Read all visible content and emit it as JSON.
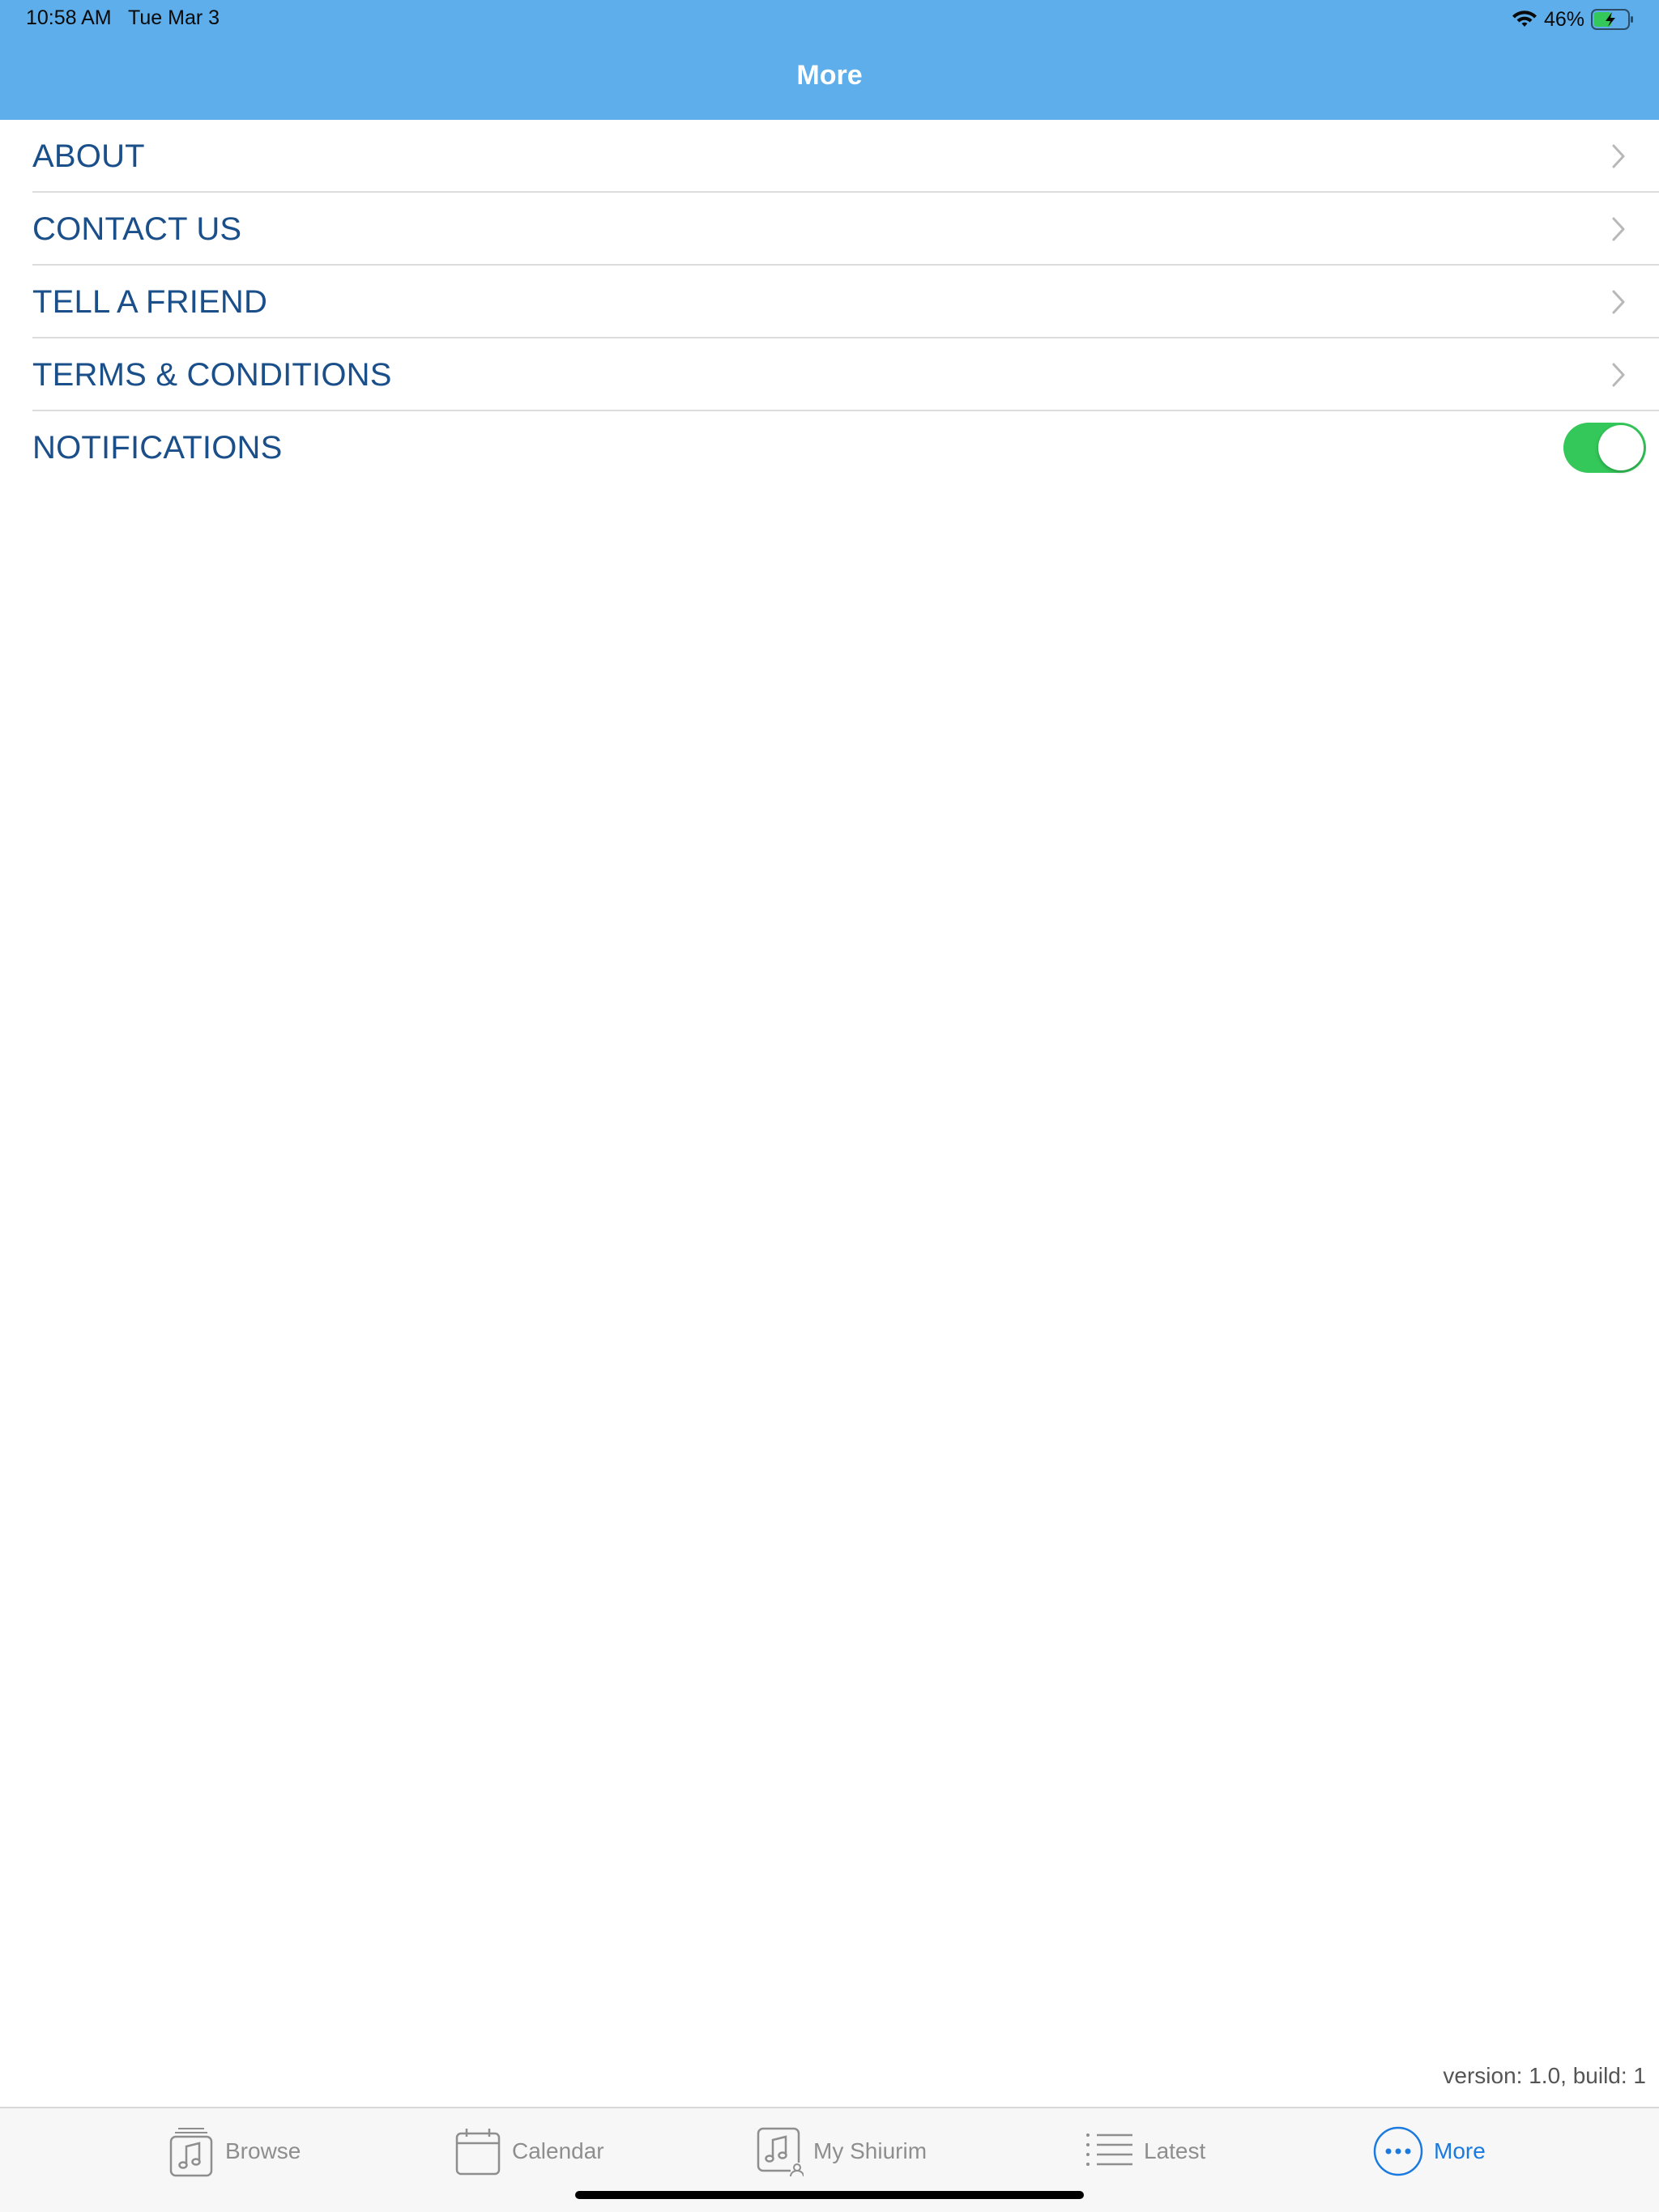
{
  "status_bar": {
    "time": "10:58 AM",
    "date": "Tue Mar 3",
    "battery": "46%"
  },
  "nav": {
    "title": "More"
  },
  "menu": {
    "items": [
      {
        "label": "ABOUT"
      },
      {
        "label": "CONTACT US"
      },
      {
        "label": "TELL A FRIEND"
      },
      {
        "label": "TERMS & CONDITIONS"
      }
    ],
    "notifications": {
      "label": "NOTIFICATIONS",
      "enabled": true
    }
  },
  "version_text": "version: 1.0, build: 1",
  "tabs": [
    {
      "label": "Browse",
      "icon": "music-note-stack-icon"
    },
    {
      "label": "Calendar",
      "icon": "calendar-icon"
    },
    {
      "label": "My Shiurim",
      "icon": "music-note-user-icon"
    },
    {
      "label": "Latest",
      "icon": "list-icon"
    },
    {
      "label": "More",
      "icon": "ellipsis-circle-icon",
      "active": true
    }
  ],
  "colors": {
    "header": "#5daeea",
    "menu_text": "#1a4f8a",
    "toggle_on": "#34c759",
    "tab_active": "#1a7ae0",
    "tab_inactive": "#8e8e8e"
  }
}
